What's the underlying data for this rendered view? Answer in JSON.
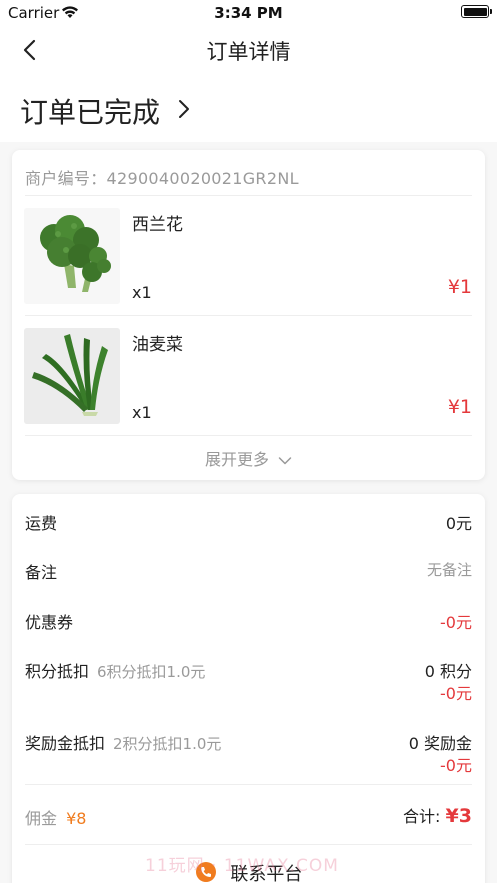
{
  "status_bar": {
    "carrier": "Carrier",
    "time": "3:34 PM"
  },
  "nav": {
    "title": "订单详情"
  },
  "order": {
    "status": "订单已完成",
    "merchant": "商户编号：4290040020021GR2NL"
  },
  "goods": [
    {
      "name": "西兰花",
      "qty": "x1",
      "price": "¥1",
      "image_icon": "broccoli-image"
    },
    {
      "name": "油麦菜",
      "qty": "x1",
      "price": "¥1",
      "image_icon": "lettuce-image"
    }
  ],
  "expand_label": "展开更多",
  "fees": {
    "shipping": {
      "label": "运费",
      "value": "0元"
    },
    "remark": {
      "label": "备注",
      "value": "无备注"
    },
    "coupon": {
      "label": "优惠券",
      "value": "-0元"
    },
    "points": {
      "label": "积分抵扣",
      "hint": "6积分抵扣1.0元",
      "amount": "0 积分",
      "value": "-0元"
    },
    "bonus": {
      "label": "奖励金抵扣",
      "hint": "2积分抵扣1.0元",
      "amount": "0 奖励金",
      "value": "-0元"
    }
  },
  "commission": {
    "label": "佣金",
    "value": "¥8"
  },
  "total": {
    "label": "合计:",
    "value": "¥3"
  },
  "contact_label": "联系平台",
  "watermark": "11玩网 · 11WAX.COM",
  "colors": {
    "accent_red": "#e4393c",
    "commission_orange": "#f07c1f",
    "muted": "#9a9a9a"
  }
}
